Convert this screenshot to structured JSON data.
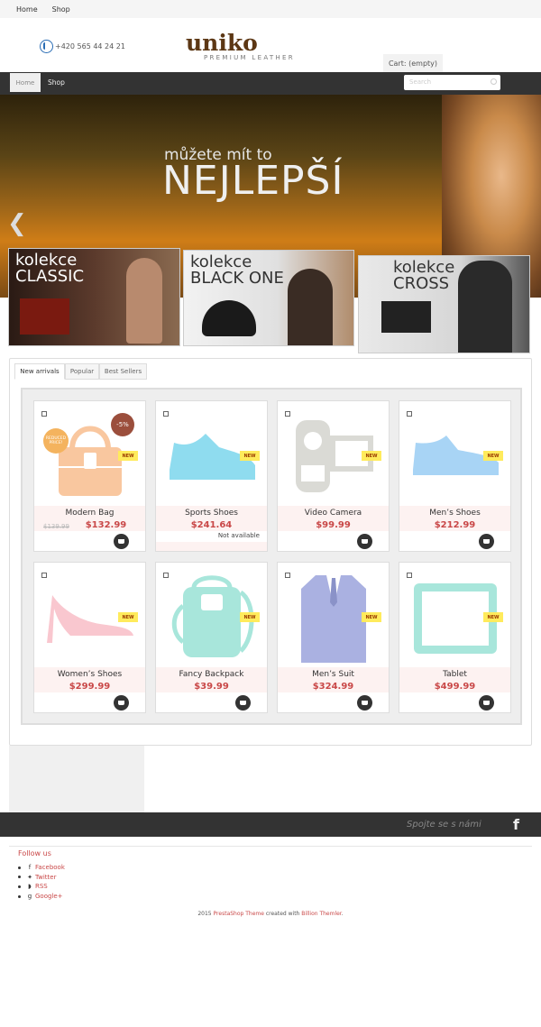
{
  "top_nav": {
    "items": [
      "Home",
      "Shop"
    ]
  },
  "header": {
    "phone": "+420 565 44 24 21",
    "logo_main": "uniko",
    "logo_sub": "PREMIUM LEATHER",
    "cart": "Cart: (empty)"
  },
  "main_nav": {
    "items": [
      "Home",
      "Shop"
    ],
    "search_placeholder": "Search"
  },
  "hero": {
    "line1": "můžete mít to",
    "line2": "NEJLEPŠÍ"
  },
  "promos": [
    {
      "line1": "kolekce",
      "line2": "CLASSIC"
    },
    {
      "line1": "kolekce",
      "line2": "BLACK ONE"
    },
    {
      "line1": "kolekce",
      "line2": "CROSS"
    }
  ],
  "tabs": [
    "New arrivals",
    "Popular",
    "Best Sellers"
  ],
  "products": [
    {
      "name": "Modern Bag",
      "price": "$132.99",
      "old_price": "$139.99",
      "badge": "-5%",
      "reduced": "REDUCED PRICE!",
      "color": "#f9c79f"
    },
    {
      "name": "Sports Shoes",
      "price": "$241.64",
      "badge_new": "NEW",
      "availability": "Not available",
      "color": "#8fdcef"
    },
    {
      "name": "Video Camera",
      "price": "$99.99",
      "badge_new": "NEW",
      "color": "#dadad5"
    },
    {
      "name": "Men’s Shoes",
      "price": "$212.99",
      "badge_new": "NEW",
      "color": "#a8d4f5"
    },
    {
      "name": "Women’s Shoes",
      "price": "$299.99",
      "badge_new": "NEW",
      "color": "#f9c7cf"
    },
    {
      "name": "Fancy Backpack",
      "price": "$39.99",
      "badge_new": "NEW",
      "color": "#a8e6db"
    },
    {
      "name": "Men’s Suit",
      "price": "$324.99",
      "badge_new": "NEW",
      "color": "#aab1e1"
    },
    {
      "name": "Tablet",
      "price": "$499.99",
      "badge_new": "NEW",
      "color": "#a8e6db"
    }
  ],
  "footer": {
    "connect": "Spojte se s námi",
    "follow_title": "Follow us",
    "social": [
      "Facebook",
      "Twitter",
      "RSS",
      "Google+"
    ],
    "copy_year": "2015",
    "copy_link1": "PrestaShop Theme",
    "copy_mid": "created with",
    "copy_link2": "Billion Themler",
    "copy_end": "."
  }
}
